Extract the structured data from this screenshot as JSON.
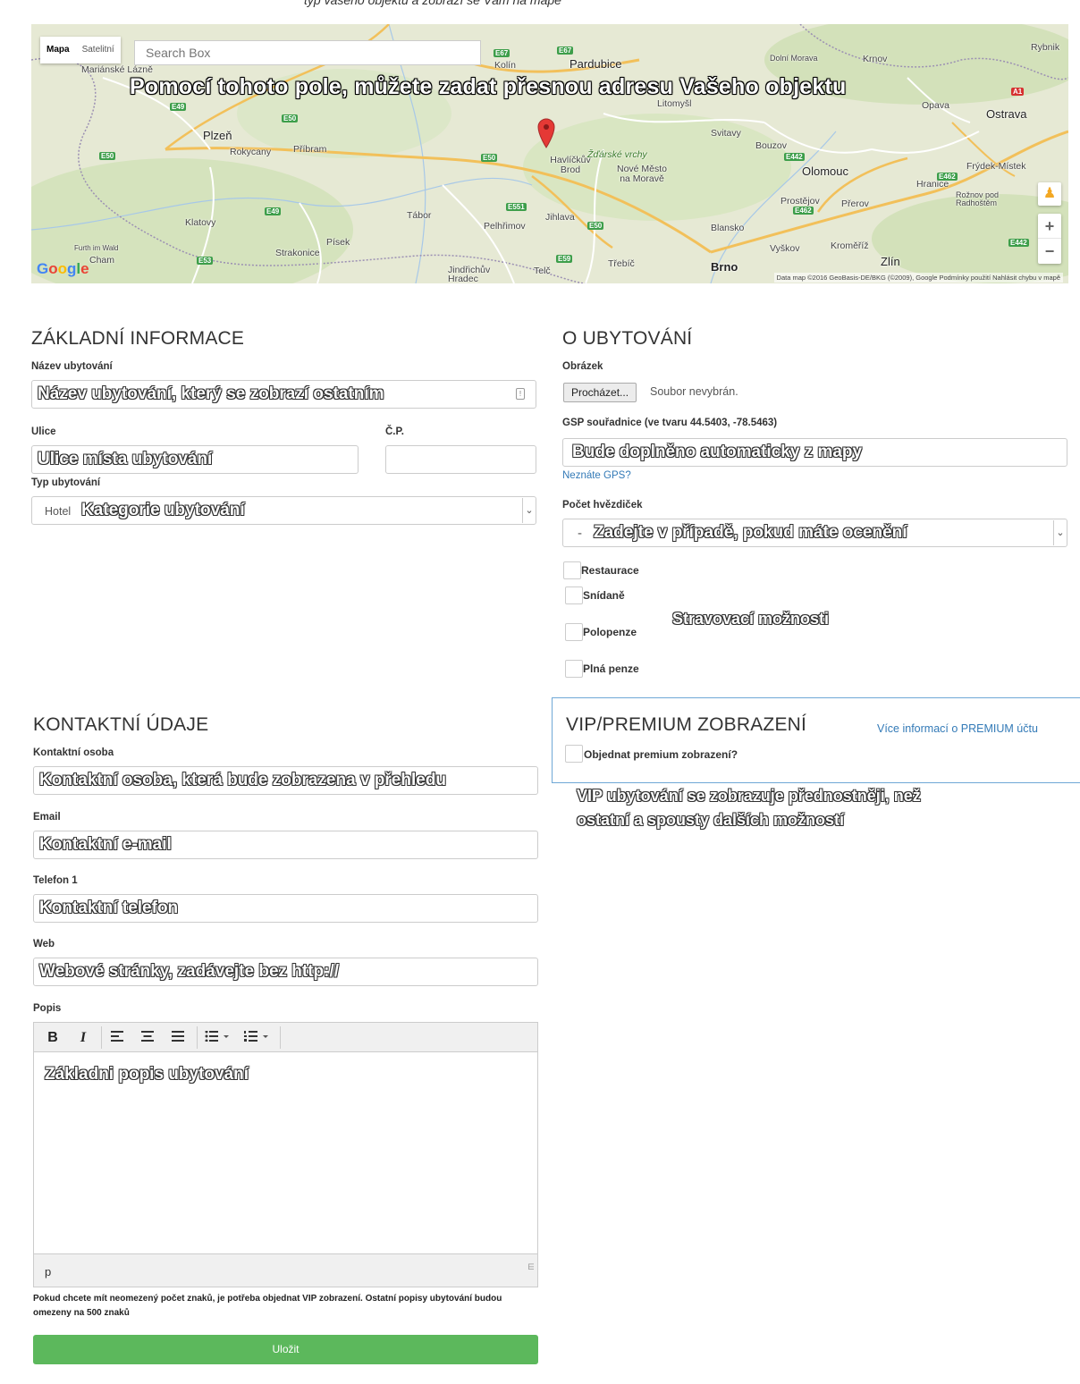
{
  "map": {
    "type_map": "Mapa",
    "type_satellite": "Satelitní",
    "search_placeholder": "Search Box",
    "callout": "Pomocí tohoto pole, můžete zadat přesnou adresu Vašeho objektu",
    "logo": "Google",
    "attribution": "Data map ©2016 GeoBasis-DE/BKG (©2009), Google   Podmínky použití   Nahlásit chybu v mapě",
    "zoom_in": "+",
    "zoom_out": "−",
    "cities": {
      "marianske": "Mariánské Lázně",
      "plzen": "Plzeň",
      "rokycany": "Rokycany",
      "pribram": "Příbram",
      "klatovy": "Klatovy",
      "furth": "Furth im Wald",
      "cham": "Cham",
      "strakonice": "Strakonice",
      "pisek": "Písek",
      "tabor": "Tábor",
      "pelhrimov": "Pelhřimov",
      "jindrichuv": "Jindřichův Hradec",
      "telc": "Telč",
      "trebic": "Třebíč",
      "jihlava": "Jihlava",
      "havlickuv": "Havlíčkův Brod",
      "zdarske": "Žďárské vrchy",
      "nove_mesto": "Nové Město na Moravě",
      "kolin": "Kolín",
      "pardubice": "Pardubice",
      "litomysl": "Litomyšl",
      "svitavy": "Svitavy",
      "bouzov": "Bouzov",
      "olomouc": "Olomouc",
      "prostejov": "Prostějov",
      "prerov": "Přerov",
      "blansko": "Blansko",
      "vyskov": "Vyškov",
      "kromeriz": "Kroměříž",
      "brno": "Brno",
      "zlin": "Zlín",
      "hranice": "Hranice",
      "roznov": "Rožnov pod Radhoštěm",
      "frydek": "Frýdek-Místek",
      "ostrava": "Ostrava",
      "opava": "Opava",
      "krnov": "Krnov",
      "rybnik": "Rybnik",
      "dolni_morava": "Dolní Morava"
    },
    "roads": [
      "E49",
      "E50",
      "E50",
      "E50",
      "E49",
      "E53",
      "E67",
      "E67",
      "E551",
      "E50",
      "E59",
      "E442",
      "E462",
      "E462",
      "E442",
      "A1"
    ]
  },
  "top_crop_text": "typ vašeho objektu a zobrazí se Vám na mapě",
  "basic": {
    "heading": "ZÁKLADNÍ INFORMACE",
    "name_label": "Název ubytování",
    "name_hint": "Název ubytování, který se zobrazí ostatním",
    "street_label": "Ulice",
    "street_hint": "Ulice místa ubytování",
    "number_label": "Č.P.",
    "type_label": "Typ ubytování",
    "type_value": "Hotel",
    "type_hint": "Kategorie ubytování"
  },
  "about": {
    "heading": "O UBYTOVÁNÍ",
    "image_label": "Obrázek",
    "browse_button": "Procházet...",
    "no_file": "Soubor nevybrán.",
    "gps_label": "GSP souřadnice (ve tvaru 44.5403, -78.5463)",
    "gps_hint": "Bude doplněno automaticky z mapy",
    "gps_link": "Neznáte GPS?",
    "stars_label": "Počet hvězdiček",
    "stars_value": "-",
    "stars_hint": "Zadejte v případě, pokud máte ocenění",
    "meals": [
      "Restaurace",
      "Snídaně",
      "Polopenze",
      "Plná penze"
    ],
    "meals_hint": "Stravovací možnosti"
  },
  "contact": {
    "heading": "KONTAKTNÍ ÚDAJE",
    "person_label": "Kontaktní osoba",
    "person_hint": "Kontaktní osoba, která bude zobrazena v přehledu",
    "email_label": "Email",
    "email_hint": "Kontaktní e-mail",
    "phone_label": "Telefon 1",
    "phone_hint": "Kontaktní telefon",
    "web_label": "Web",
    "web_hint": "Webové stránky, zadávejte bez http://",
    "desc_label": "Popis",
    "desc_hint": "Základni popis ubytování",
    "status_path": "p",
    "note": "Pokud chcete mít neomezený počet znaků, je potřeba objednat VIP zobrazení. Ostatní popisy ubytování budou omezeny na 500 znaků",
    "save_button": "Uložit"
  },
  "vip": {
    "heading": "VIP/PREMIUM ZOBRAZENÍ",
    "more_link": "Více informací o PREMIUM účtu",
    "order_label": "Objednat premium zobrazení?",
    "hint_line1": "VIP ubytování se zobrazuje přednostněji, než",
    "hint_line2": "ostatní a spousty dalších možností"
  },
  "toolbar": {
    "bold": "B",
    "italic": "I",
    "align_left": "align-left-icon",
    "align_center": "align-center-icon",
    "justify": "justify-icon",
    "bullets": "bullet-list-icon",
    "numbers": "numbered-list-icon"
  },
  "colors": {
    "save": "#5cb85c",
    "link": "#337ab7",
    "vip_border": "#6fa8d6",
    "pin": "#e53935"
  }
}
